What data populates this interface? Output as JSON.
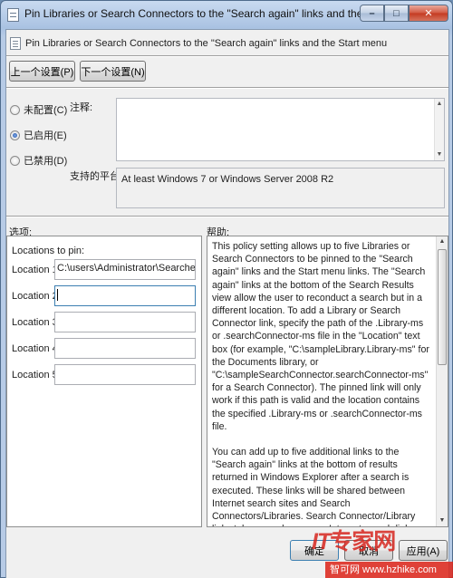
{
  "window": {
    "title": "Pin Libraries or Search Connectors to the \"Search again\" links and the Start menu",
    "min_glyph": "–",
    "max_glyph": "□",
    "close_glyph": "✕"
  },
  "header": {
    "title": "Pin Libraries or Search Connectors to the \"Search again\" links and the Start menu",
    "prev_label": "上一个设置(P)",
    "next_label": "下一个设置(N)"
  },
  "state": {
    "options": [
      {
        "label": "未配置(C)",
        "selected": false
      },
      {
        "label": "已启用(E)",
        "selected": true
      },
      {
        "label": "已禁用(D)",
        "selected": false
      }
    ]
  },
  "comment": {
    "label": "注释:",
    "value": ""
  },
  "supported": {
    "label": "支持的平台:",
    "value": "At least Windows 7 or Windows Server 2008 R2"
  },
  "options_label": "选项:",
  "help_label": "帮助:",
  "locations": {
    "heading": "Locations to pin:",
    "rows": [
      {
        "label": "Location 1",
        "value": "C:\\users\\Administrator\\Searches\\MSDN.osdx"
      },
      {
        "label": "Location 2",
        "value": ""
      },
      {
        "label": "Location 3",
        "value": ""
      },
      {
        "label": "Location 4",
        "value": ""
      },
      {
        "label": "Location 5",
        "value": ""
      }
    ]
  },
  "help": {
    "p1": "This policy setting allows up to five Libraries or Search Connectors to be pinned to the \"Search again\" links and the Start menu links. The \"Search again\" links at the bottom of the Search Results view allow the user to reconduct a search but in a different location.  To add a Library or Search Connector link, specify the path of the .Library-ms or .searchConnector-ms file in the \"Location\" text box (for example, \"C:\\sampleLibrary.Library-ms\" for the Documents library, or \"C:\\sampleSearchConnector.searchConnector-ms\" for a Search Connector). The pinned link will only work if this path is valid and the location contains the specified .Library-ms or .searchConnector-ms file.",
    "p2": "You can add up to five additional links to the \"Search again\" links at the bottom of results returned in Windows Explorer after a search is executed.  These links will be shared between Internet search sites and Search Connectors/Libraries.  Search Connector/Library links take precedence over Internet search links."
  },
  "footer": {
    "ok_label": "确定",
    "cancel_label": "取消",
    "apply_label": "应用(A)"
  },
  "watermark": {
    "logo_latin": "IT",
    "logo_cn": "专家网",
    "url_text": "智可网 www.hzhike.com"
  }
}
